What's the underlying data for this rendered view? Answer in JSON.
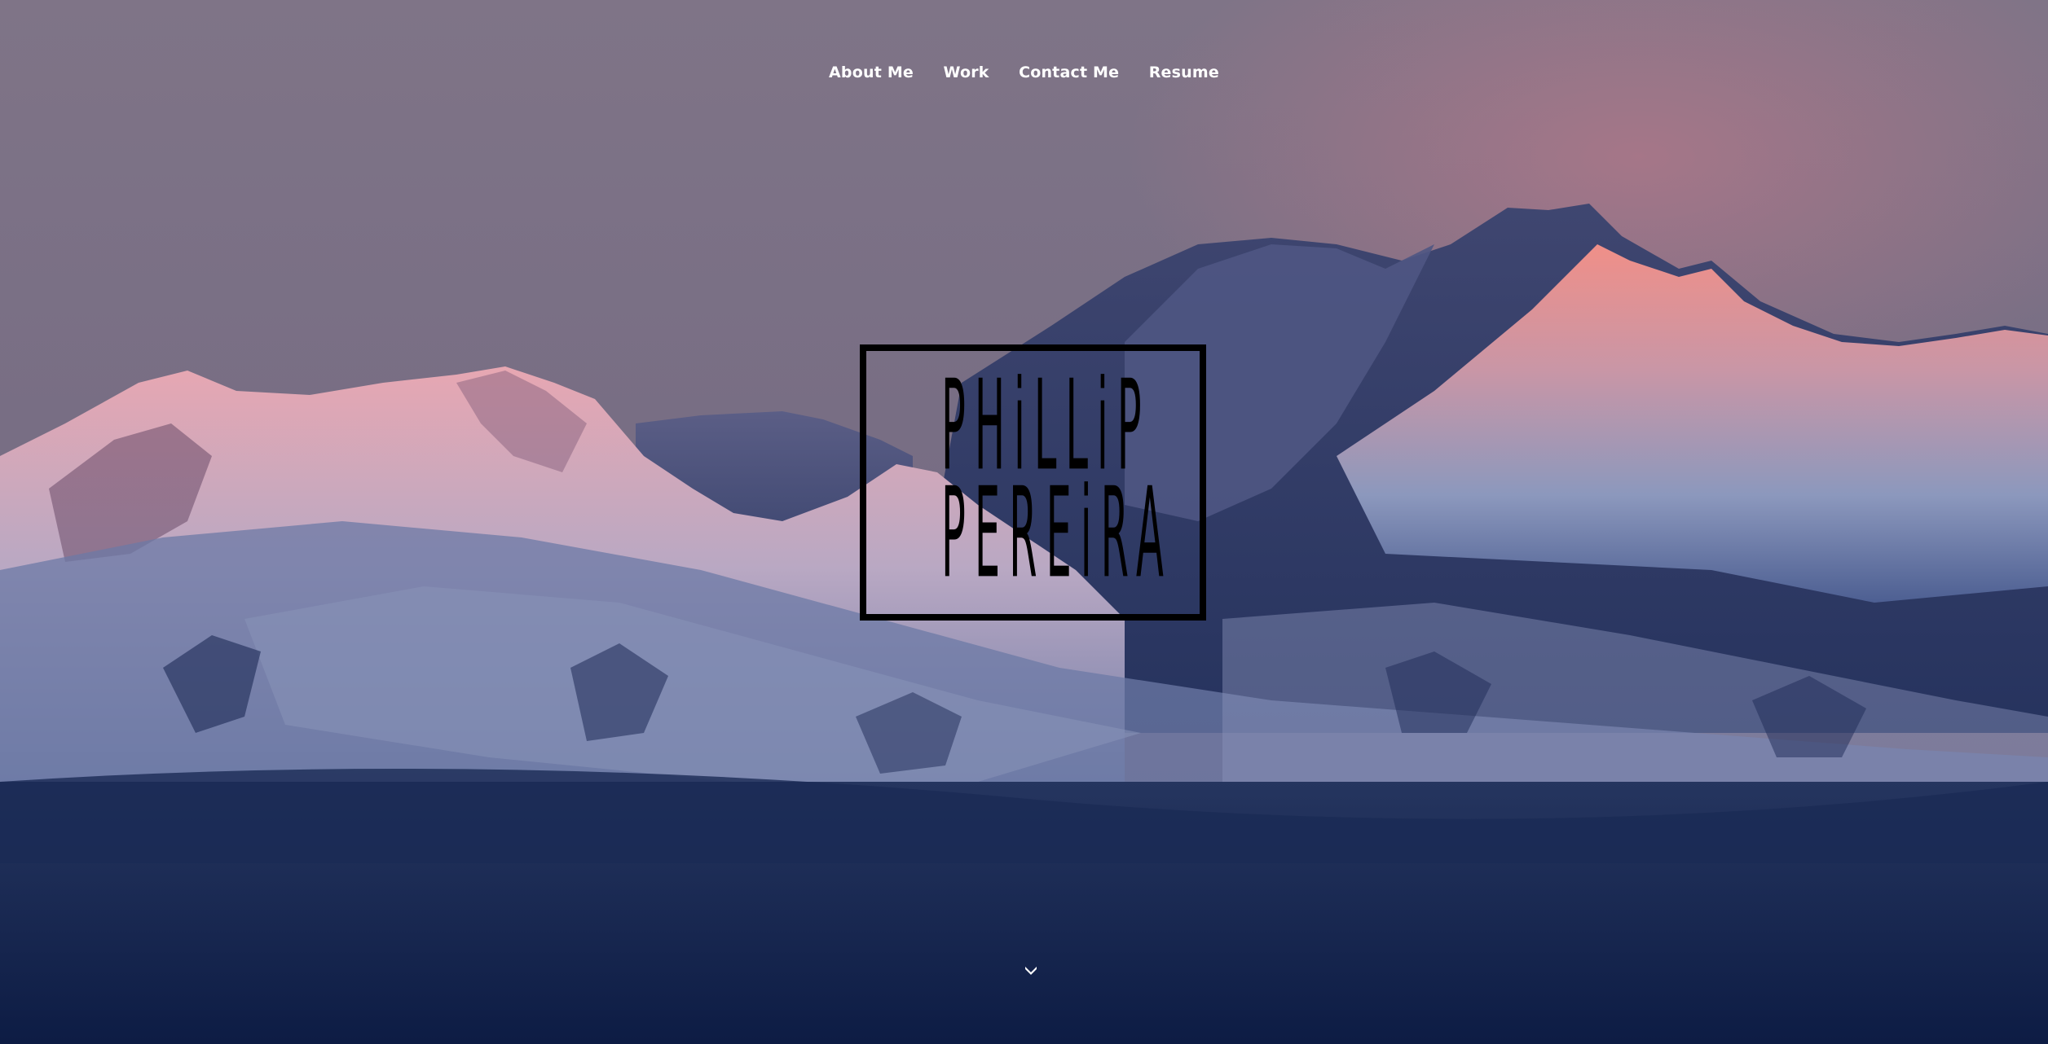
{
  "nav": {
    "items": [
      {
        "label": "About Me"
      },
      {
        "label": "Work"
      },
      {
        "label": "Contact Me"
      },
      {
        "label": "Resume"
      }
    ]
  },
  "logo": {
    "line1": "PHiLLiP",
    "line2": "PEREiRA"
  },
  "scroll": {
    "icon": "chevron-down-icon"
  },
  "colors": {
    "nav_text": "#ffffff",
    "logo_ink": "#000000",
    "sky_top": "#7e7286",
    "valley_bottom": "#0f1f46"
  }
}
